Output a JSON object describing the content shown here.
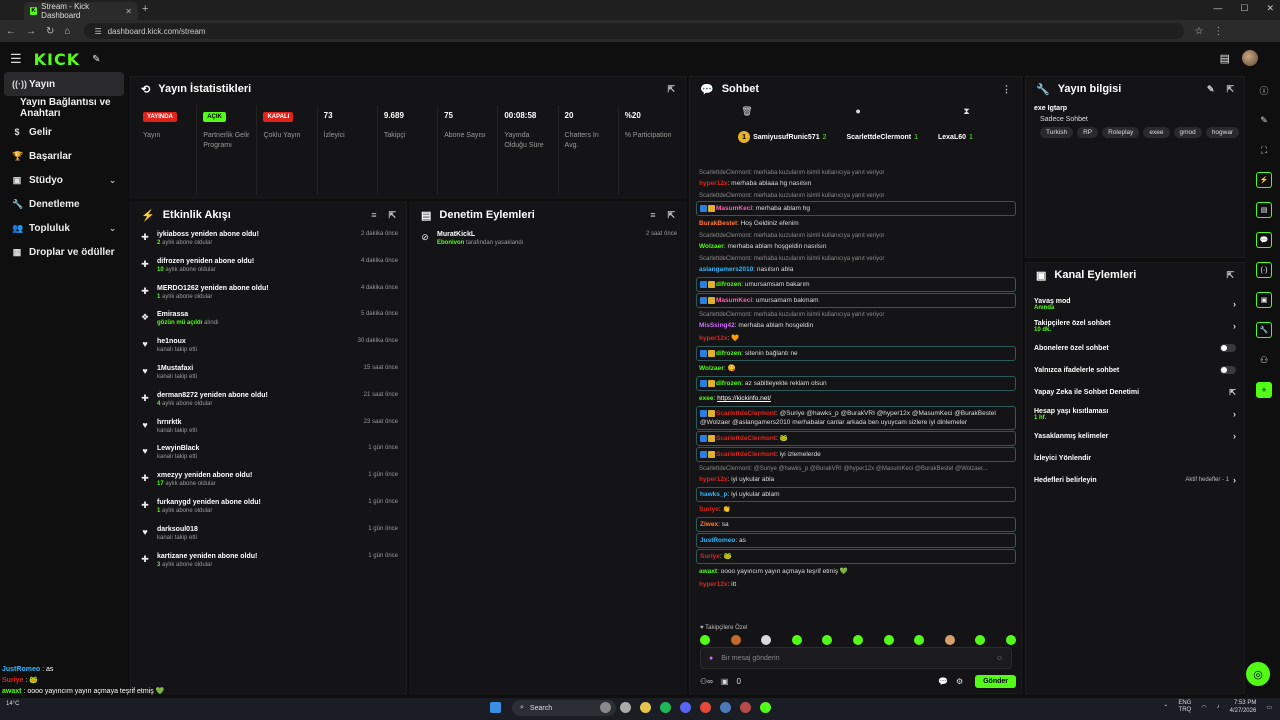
{
  "browser": {
    "tab_title": "Stream - Kick Dashboard",
    "tab_favicon": "K",
    "new_tab": "+",
    "url": "dashboard.kick.com/stream"
  },
  "header": {
    "logo": "KICK"
  },
  "sidebar": {
    "items": [
      {
        "label": "Yayın",
        "icon": "broadcast-icon",
        "glyph": "((·))",
        "active": true
      },
      {
        "label": "Yayın Bağlantısı ve Anahtarı",
        "icon": "",
        "glyph": ""
      },
      {
        "label": "Gelir",
        "icon": "dollar-icon",
        "glyph": "$"
      },
      {
        "label": "Başarılar",
        "icon": "trophy-icon",
        "glyph": "🏆"
      },
      {
        "label": "Stüdyo",
        "icon": "studio-icon",
        "glyph": "▣",
        "chevron": true
      },
      {
        "label": "Denetleme",
        "icon": "wrench-icon",
        "glyph": "🔧"
      },
      {
        "label": "Topluluk",
        "icon": "community-icon",
        "glyph": "👥",
        "chevron": true
      },
      {
        "label": "Droplar ve ödüller",
        "icon": "gift-icon",
        "glyph": "▦"
      }
    ]
  },
  "stats": {
    "title": "Yayın İstatistikleri",
    "items": [
      {
        "badge": "YAYINDA",
        "badge_color": "#e0241c",
        "label": "Yayın"
      },
      {
        "badge": "AÇIK",
        "badge_color": "#53fc18",
        "label": "Partnerlik Gelir Programı"
      },
      {
        "badge": "KAPALI",
        "badge_color": "#e0241c",
        "label": "Çoklu Yayın"
      },
      {
        "value": "73",
        "label": "İzleyici"
      },
      {
        "value": "9.689",
        "label": "Takipçi"
      },
      {
        "value": "75",
        "label": "Abone Sayısı"
      },
      {
        "value": "00:08:58",
        "label": "Yayında Olduğu Süre"
      },
      {
        "value": "20",
        "label": "Chatters In Avg."
      },
      {
        "value": "%20",
        "label": "% Participation"
      }
    ]
  },
  "activity": {
    "title": "Etkinlik Akışı",
    "items": [
      {
        "icon": "subscribe-icon",
        "name": "iykiaboss yeniden abone oldu!",
        "count": "2",
        "sub": "aylık abone oldular",
        "time": "2 dakika önce"
      },
      {
        "icon": "subscribe-icon",
        "name": "difrozen yeniden abone oldu!",
        "count": "10",
        "sub": "aylık abone oldular",
        "time": "4 dakika önce"
      },
      {
        "icon": "subscribe-icon",
        "name": "MERDO1262 yeniden abone oldu!",
        "count": "1",
        "sub": "aylık abone oldular",
        "time": "4 dakika önce"
      },
      {
        "icon": "gift-icon",
        "name": "Emirassa",
        "count": "gözün mü açıldı",
        "sub": "alındı",
        "time": "5 dakika önce"
      },
      {
        "icon": "heart-icon",
        "name": "he1noux",
        "count": "",
        "sub": "kanalı takip etti",
        "time": "30 dakika önce"
      },
      {
        "icon": "heart-icon",
        "name": "1Mustafaxi",
        "count": "",
        "sub": "kanalı takip etti",
        "time": "15 saat önce"
      },
      {
        "icon": "subscribe-icon",
        "name": "derman8272 yeniden abone oldu!",
        "count": "4",
        "sub": "aylık abone oldular",
        "time": "21 saat önce"
      },
      {
        "icon": "heart-icon",
        "name": "hrrırktk",
        "count": "",
        "sub": "kanalı takip etti",
        "time": "23 saat önce"
      },
      {
        "icon": "heart-icon",
        "name": "LewyinBlack",
        "count": "",
        "sub": "kanalı takip etti",
        "time": "1 gün önce"
      },
      {
        "icon": "subscribe-icon",
        "name": "xmezyy yeniden abone oldu!",
        "count": "17",
        "sub": "aylık abone oldular",
        "time": "1 gün önce"
      },
      {
        "icon": "subscribe-icon",
        "name": "furkanygd yeniden abone oldu!",
        "count": "1",
        "sub": "aylık abone oldular",
        "time": "1 gün önce"
      },
      {
        "icon": "heart-icon",
        "name": "darksoul018",
        "count": "",
        "sub": "kanalı takip etti",
        "time": "1 gün önce"
      },
      {
        "icon": "subscribe-icon",
        "name": "kartizane yeniden abone oldu!",
        "count": "3",
        "sub": "aylık abone oldular",
        "time": "1 gün önce"
      }
    ]
  },
  "audit": {
    "title": "Denetim Eylemleri",
    "items": [
      {
        "name": "MuratKickL",
        "by": "Ebonivon",
        "sub": "tarafından yasaklandı",
        "time": "2 saat önce"
      }
    ]
  },
  "chat": {
    "title": "Sohbet",
    "pinned": [
      {
        "name": "SamiyusufRunic571",
        "count": "2",
        "rank": "1"
      },
      {
        "name": "ScarlettdeClermont",
        "count": "1",
        "rank": ""
      },
      {
        "name": "LexaL60",
        "count": "1",
        "rank": ""
      }
    ],
    "messages": [
      {
        "reply": "ScarlettdeClermont: merhaba kuzularım isimli kullanıcıya yanıt veriyor"
      },
      {
        "user": "hyper12x",
        "color": "#e0241c",
        "text": "merhaba ablaaa hg nasılsın"
      },
      {
        "reply": "ScarlettdeClermont: merhaba kuzularım isimli kullanıcıya yanıt veriyor"
      },
      {
        "user": "MasumKeci",
        "color": "#ff5fb2",
        "text": "merhaba ablam hg",
        "hl": true,
        "mod": true
      },
      {
        "user": "BurakBestel",
        "color": "#ff7a3b",
        "text": "Hoş Geldiniz efenim"
      },
      {
        "reply": "ScarlettdeClermont: merhaba kuzularım isimli kullanıcıya yanıt veriyor"
      },
      {
        "user": "Wolzaer",
        "color": "#53fc18",
        "text": "merhaba ablam hoşgeldin nasılsın"
      },
      {
        "reply": "ScarlettdeClermont: merhaba kuzularım isimli kullanıcıya yanıt veriyor"
      },
      {
        "user": "aslangamers2010",
        "color": "#2fb8ff",
        "text": "nasılsın abla"
      },
      {
        "user": "difrozen",
        "color": "#53fc18",
        "text": "umursamsam bakarım",
        "hl": true,
        "mod": true
      },
      {
        "user": "MasumKeci",
        "color": "#ff5fb2",
        "text": "umursamam bakmam",
        "hl": true,
        "mod": true
      },
      {
        "reply": "ScarlettdeClermont: merhaba kuzularım isimli kullanıcıya yanıt veriyor"
      },
      {
        "user": "MisSsing42",
        "color": "#d36bff",
        "text": "merhaba ablam hosgeldin"
      },
      {
        "user": "hyper12x",
        "color": "#e0241c",
        "text": "🧡"
      },
      {
        "user": "difrozen",
        "color": "#53fc18",
        "text": "sitenin bağlantı ne",
        "hl": true,
        "mod": true
      },
      {
        "user": "Wolzaer",
        "color": "#53fc18",
        "text": "😋"
      },
      {
        "user": "difrozen",
        "color": "#53fc18",
        "text": "az sabitleyekte reklam olsun",
        "hl": true,
        "mod": true
      },
      {
        "user": "exee",
        "color": "#53fc18",
        "text": "",
        "link": "https://kickinfo.net/"
      },
      {
        "user": "ScarlettdeClermont",
        "color": "#e0241c",
        "text": "@Suriye @hawks_p @BurakVRI @hyper12x @MasumKeci @BurakBestel @Wolzaer @aslangamers2010 merhabalar canlar arkada ben uyuycam sizlere iyi dinlemeler",
        "hl": true,
        "mod": true
      },
      {
        "user": "ScarlettdeClermont",
        "color": "#e0241c",
        "text": "🐸",
        "hl": true,
        "mod": true
      },
      {
        "user": "ScarlettdeClermont",
        "color": "#e0241c",
        "text": "iyi izlemelerde",
        "hl": true,
        "mod": true
      },
      {
        "reply": "ScarlettdeClermont: @Suriye @hawks_p @BurakVRI @hyper12x @MasumKeci @BurakBestel @Wolzaer..."
      },
      {
        "user": "hyper12x",
        "color": "#e0241c",
        "text": "iyi uykular abla"
      },
      {
        "user": "hawks_p",
        "color": "#2fb8ff",
        "text": "iyi uykular ablam",
        "hl": true
      },
      {
        "user": "Suriye",
        "color": "#e0241c",
        "text": "👏"
      },
      {
        "user": "Ziwex",
        "color": "#ff7a3b",
        "text": "sa",
        "hl": true
      },
      {
        "user": "JustRomeo",
        "color": "#2fb8ff",
        "text": "as",
        "hl": true
      },
      {
        "user": "Suriye",
        "color": "#e0241c",
        "text": "🐸",
        "hl": true
      },
      {
        "user": "awaxt",
        "color": "#53fc18",
        "text": "oooo yayıncım yayın açmaya teşrif etmiş 💚"
      },
      {
        "user": "hyper12x",
        "color": "#e0241c",
        "text": "itt"
      }
    ],
    "emote_label": "Takipçilere Özel",
    "input_placeholder": "Bir mesaj gönderin",
    "bottom_count": "0",
    "send_label": "Gönder"
  },
  "info": {
    "title": "Yayın bilgisi",
    "stream_title": "exe Igtarp",
    "chat_mode": "Sadece Sohbet",
    "tags": [
      "Turkish",
      "RP",
      "Roleplay",
      "exee",
      "gmod",
      "hogwar"
    ]
  },
  "channel_actions": {
    "title": "Kanal Eylemleri",
    "rows": [
      {
        "label": "Yavaş mod",
        "sub": "Anında",
        "control": "chevron"
      },
      {
        "label": "Takipçilere özel sohbet",
        "sub": "10 dk.",
        "control": "chevron"
      },
      {
        "label": "Abonelere özel sohbet",
        "sub": "",
        "control": "toggle"
      },
      {
        "label": "Yalnızca ifadelerle sohbet",
        "sub": "",
        "control": "toggle"
      },
      {
        "label": "Yapay Zeka ile Sohbet Denetimi",
        "sub": "",
        "control": "external"
      },
      {
        "label": "Hesap yaşı kısıtlaması",
        "sub": "1 hf.",
        "control": "chevron"
      },
      {
        "label": "Yasaklanmış kelimeler",
        "sub": "",
        "control": "chevron"
      },
      {
        "label": "İzleyici Yönlendir",
        "sub": "",
        "control": ""
      },
      {
        "label": "Hedefleri belirleyin",
        "sub": "",
        "control": "chevron",
        "right_text": "Aktif hedefler - 1"
      }
    ]
  },
  "overlay": [
    {
      "user": "JustRomeo",
      "color": "#2fb8ff",
      "text": "as"
    },
    {
      "user": "Suriye",
      "color": "#e0241c",
      "text": "🐸"
    },
    {
      "user": "awaxt",
      "color": "#53fc18",
      "text": "oooo yayıncım yayın açmaya teşrif etmiş 💚"
    },
    {
      "user": "hyper12x",
      "color": "#e0241c",
      "text": "itt"
    }
  ],
  "taskbar": {
    "search": "Search",
    "weather_temp": "14°C",
    "lang": "ENG",
    "lang2": "TRQ",
    "time": "7:53 PM",
    "date": "4/27/2026"
  },
  "colors": {
    "accent": "#53fc18",
    "danger": "#e0241c",
    "bg": "#0f0f10",
    "panel": "#141416"
  }
}
